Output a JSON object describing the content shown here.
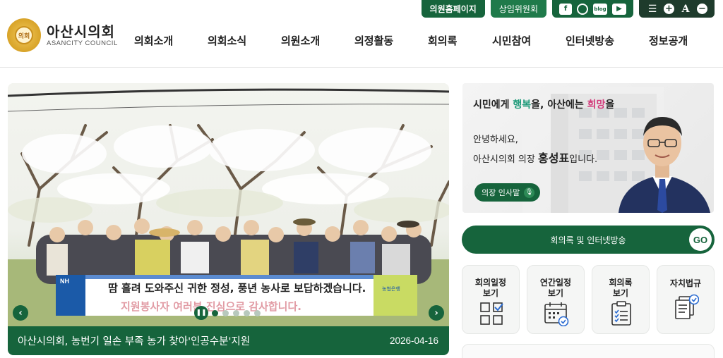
{
  "util": {
    "homepage_label": "의원홈페이지",
    "committee_label": "상임위원회",
    "sns": [
      "facebook-icon",
      "instagram-icon",
      "blog-icon",
      "youtube-icon"
    ],
    "blog_text": "blog",
    "tools": [
      "menu-icon",
      "zoom-in-icon",
      "font-icon",
      "zoom-out-icon"
    ],
    "font_tool_text": "A"
  },
  "logo": {
    "name": "아산시의회",
    "english": "ASANCITY COUNCIL",
    "seal_text": "의회"
  },
  "gnb": [
    "의회소개",
    "의회소식",
    "의원소개",
    "의정활동",
    "회의록",
    "시민참여",
    "인터넷방송",
    "정보공개"
  ],
  "slider": {
    "caption": "아산시의회, 농번기 일손 부족 농가 찾아'인공수분'지원",
    "date": "2026-04-16",
    "banner_line1": "땀 흘려 도와주신 귀한 정성, 풍년 농사로 보답하겠습니다.",
    "banner_line2": "지원봉사자 여러분 진심으로 감사합니다.",
    "banner_logo_left": "NH",
    "banner_logo_right": "농협은행",
    "slide_count": 5,
    "active_slide": 1
  },
  "chair": {
    "line1_a": "시민에게 ",
    "line1_b": "행복",
    "line1_c": "을, 아산에는 ",
    "line1_d": "희망",
    "line1_e": "을",
    "line2": "안녕하세요,",
    "line3_a": "아산시의회 의장 ",
    "line3_b": "홍성표",
    "line3_c": "입니다.",
    "greet_label": "의장 인사말"
  },
  "go_bar": {
    "label": "회의록 및 인터넷방송",
    "go": "GO"
  },
  "tiles": [
    {
      "label": "회의일정\n보기",
      "icon": "grid-check-icon"
    },
    {
      "label": "연간일정\n보기",
      "icon": "calendar-check-icon"
    },
    {
      "label": "회의록\n보기",
      "icon": "clipboard-list-icon"
    },
    {
      "label": "자치법규",
      "icon": "documents-check-icon"
    }
  ],
  "colors": {
    "brand_green": "#16643c",
    "accent_teal": "#1d9a79",
    "accent_pink": "#d23b7b"
  }
}
